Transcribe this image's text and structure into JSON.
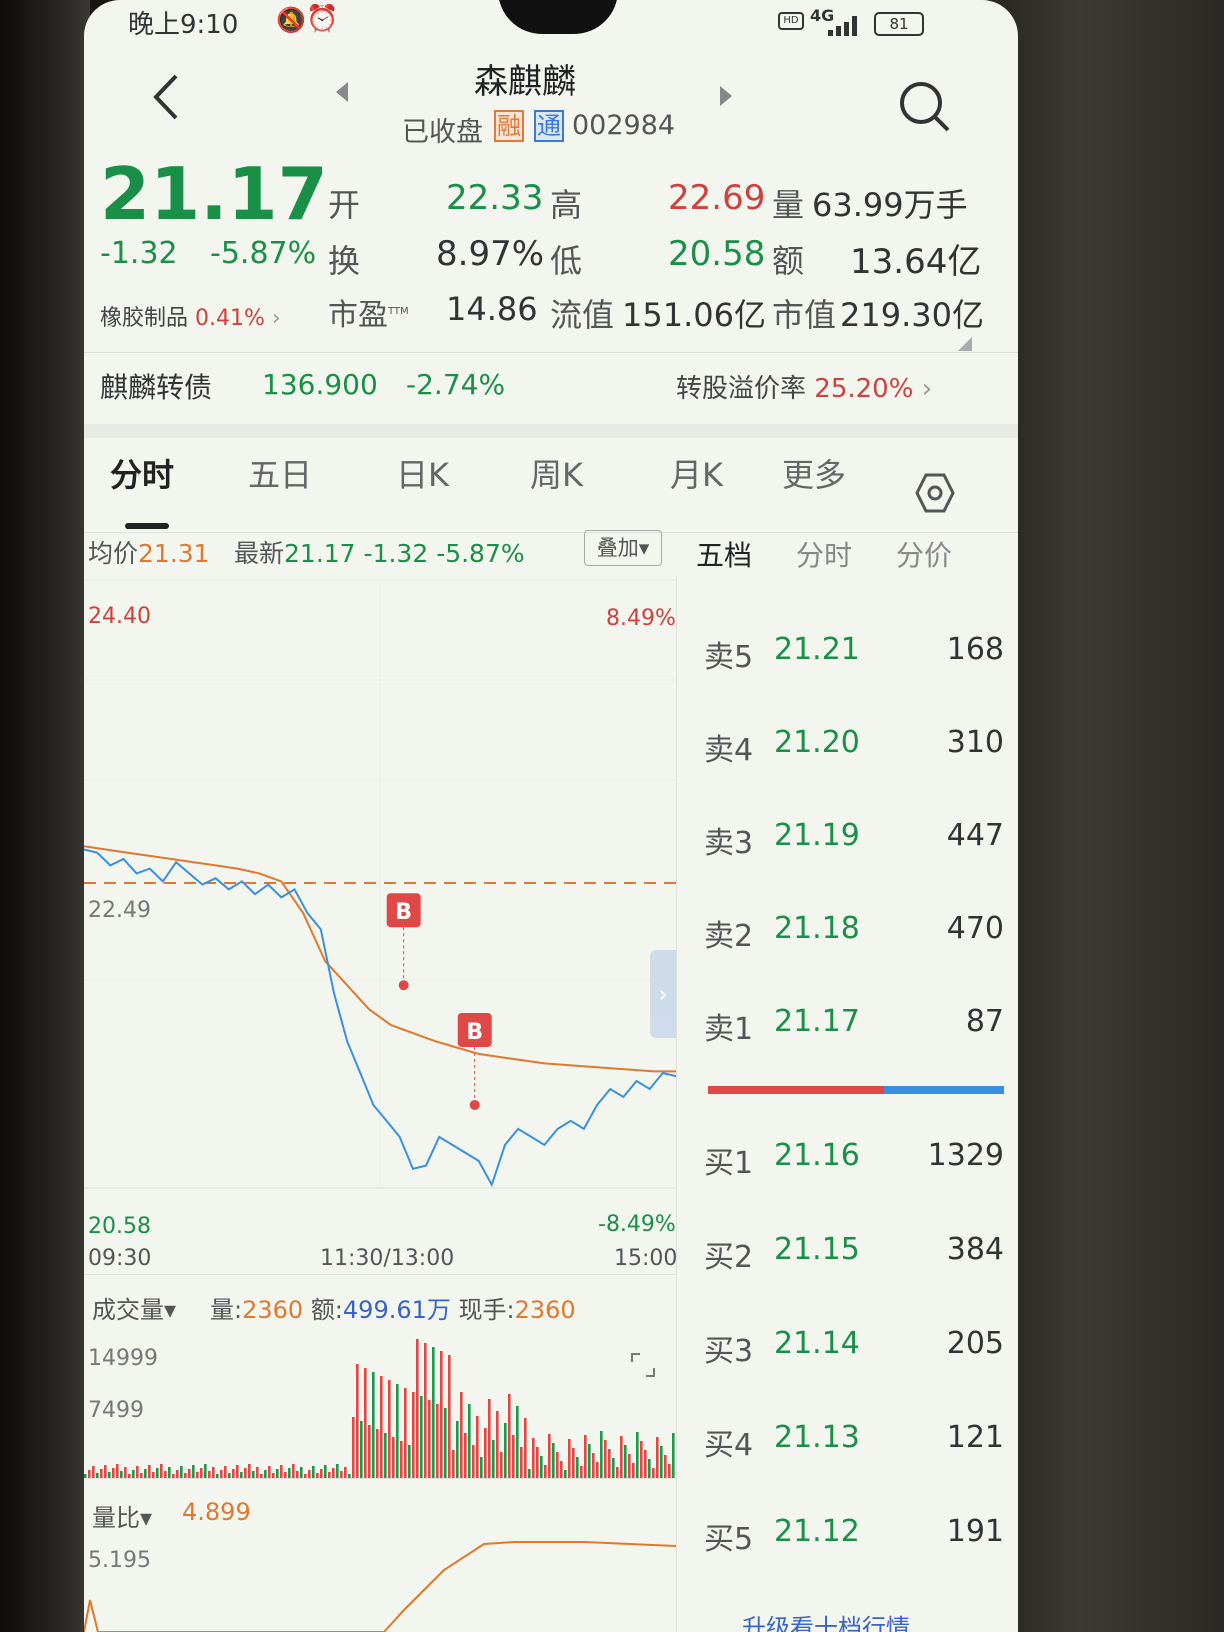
{
  "status_bar": {
    "time": "晚上9:10",
    "network": "4G",
    "battery": "81"
  },
  "header": {
    "title": "森麒麟",
    "status": "已收盘",
    "badge_rong": "融",
    "badge_tong": "通",
    "code": "002984"
  },
  "quote": {
    "price": "21.17",
    "change": "-1.32",
    "change_pct": "-5.87%",
    "open_label": "开",
    "open": "22.33",
    "high_label": "高",
    "high": "22.69",
    "vol_label": "量",
    "vol": "63.99万手",
    "turnover_label": "换",
    "turnover": "8.97%",
    "low_label": "低",
    "low": "20.58",
    "amount_label": "额",
    "amount": "13.64亿",
    "sector": "橡胶制品",
    "sector_pct": "0.41%",
    "pe_label": "市盈",
    "pe_sup": "TTM",
    "pe": "14.86",
    "float_label": "流值",
    "float": "151.06亿",
    "mcap_label": "市值",
    "mcap": "219.30亿"
  },
  "bond": {
    "name": "麒麟转债",
    "price": "136.900",
    "pct": "-2.74%",
    "premium_label": "转股溢价率",
    "premium": "25.20%"
  },
  "tabs": [
    "分时",
    "五日",
    "日K",
    "周K",
    "月K",
    "更多"
  ],
  "chart_header": {
    "avg_label": "均价",
    "avg": "21.31",
    "latest_label": "最新",
    "latest": "21.17",
    "chg": "-1.32",
    "pct": "-5.87%",
    "overlay": "叠加"
  },
  "orderbook_tabs": [
    "五档",
    "分时",
    "分价"
  ],
  "chart_labels": {
    "ymax": "24.40",
    "ymin": "20.58",
    "pmax": "8.49%",
    "pmin": "-8.49%",
    "prev": "22.49",
    "t_start": "09:30",
    "t_mid": "11:30/13:00",
    "t_end": "15:00",
    "marker": "B"
  },
  "volume_header": {
    "selector": "成交量",
    "vol_label": "量:",
    "vol": "2360",
    "amt_label": "额:",
    "amt": "499.61万",
    "hand_label": "现手:",
    "hand": "2360",
    "ymax": "14999",
    "ymid": "7499"
  },
  "ratio": {
    "selector": "量比",
    "value": "4.899",
    "ymax": "5.195"
  },
  "orderbook": {
    "asks": [
      {
        "label": "卖5",
        "price": "21.21",
        "vol": "168"
      },
      {
        "label": "卖4",
        "price": "21.20",
        "vol": "310"
      },
      {
        "label": "卖3",
        "price": "21.19",
        "vol": "447"
      },
      {
        "label": "卖2",
        "price": "21.18",
        "vol": "470"
      },
      {
        "label": "卖1",
        "price": "21.17",
        "vol": "87"
      }
    ],
    "bids": [
      {
        "label": "买1",
        "price": "21.16",
        "vol": "1329"
      },
      {
        "label": "买2",
        "price": "21.15",
        "vol": "384"
      },
      {
        "label": "买3",
        "price": "21.14",
        "vol": "205"
      },
      {
        "label": "买4",
        "price": "21.13",
        "vol": "121"
      },
      {
        "label": "买5",
        "price": "21.12",
        "vol": "191"
      }
    ],
    "footer": "升级看十档行情"
  },
  "chart_data": {
    "type": "line",
    "ylim": [
      20.58,
      24.4
    ],
    "prev_close": 22.49,
    "x": [
      "09:30",
      "11:30/13:00",
      "15:00"
    ],
    "series": [
      {
        "values": [
          22.7,
          22.68,
          22.6,
          22.64,
          22.55,
          22.58,
          22.5,
          22.62,
          22.55,
          22.48,
          22.52,
          22.45,
          22.5,
          22.42,
          22.48,
          22.4,
          22.45,
          22.3,
          22.2,
          21.8,
          21.5,
          21.3,
          21.1,
          21.0,
          20.9,
          20.7,
          20.72,
          20.9,
          20.85,
          20.8,
          20.75,
          20.6,
          20.85,
          20.95,
          20.9,
          20.85,
          20.95,
          21.0,
          20.95,
          21.1,
          21.2,
          21.15,
          21.25,
          21.2,
          21.3,
          21.28
        ]
      },
      {
        "values": [
          22.72,
          22.7,
          22.68,
          22.66,
          22.64,
          22.62,
          22.6,
          22.58,
          22.55,
          22.5,
          22.3,
          22.0,
          21.85,
          21.7,
          21.6,
          21.55,
          21.5,
          21.46,
          21.42,
          21.4,
          21.38,
          21.36,
          21.35,
          21.34,
          21.33,
          21.32,
          21.31,
          21.31
        ]
      }
    ],
    "markers": [
      {
        "label": "B",
        "x": 0.54,
        "y": 21.85
      },
      {
        "label": "B",
        "x": 0.66,
        "y": 21.1
      }
    ]
  }
}
